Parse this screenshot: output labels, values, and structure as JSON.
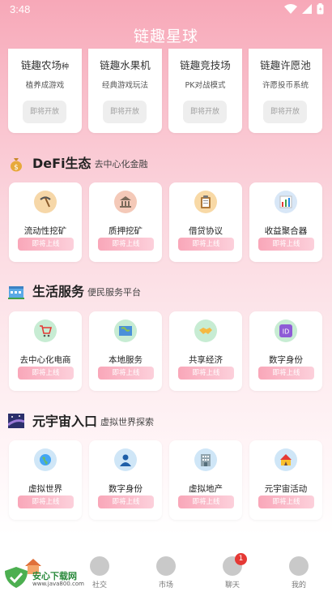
{
  "status_bar": {
    "time": "3:48"
  },
  "app": {
    "title": "链趣星球"
  },
  "games": [
    {
      "name": "链趣农场",
      "suffix": "种",
      "desc": "植养成游戏",
      "button": "即将开放"
    },
    {
      "name": "链趣水果机",
      "suffix": "",
      "desc": "经典游戏玩法",
      "button": "即将开放"
    },
    {
      "name": "链趣竞技场",
      "suffix": "",
      "desc": "PK对战模式",
      "button": "即将开放"
    },
    {
      "name": "链趣许愿池",
      "suffix": "",
      "desc": "许愿投币系统",
      "button": "即将开放"
    }
  ],
  "sections": {
    "defi": {
      "title": "DeFi生态",
      "subtitle": "去中心化金融",
      "icon": "money-bag-icon",
      "items": [
        {
          "label": "流动性挖矿",
          "button": "即将上线",
          "icon": "pickaxe-icon",
          "color": "#f6d7a8"
        },
        {
          "label": "质押挖矿",
          "button": "即将上线",
          "icon": "bank-icon",
          "color": "#f4c9b8"
        },
        {
          "label": "借贷协议",
          "button": "即将上线",
          "icon": "clipboard-icon",
          "color": "#f8d9a6"
        },
        {
          "label": "收益聚合器",
          "button": "即将上线",
          "icon": "bar-chart-icon",
          "color": "#d8e7f7"
        }
      ]
    },
    "life": {
      "title": "生活服务",
      "subtitle": "便民服务平台",
      "icon": "cityscape-icon",
      "items": [
        {
          "label": "去中心化电商",
          "button": "即将上线",
          "icon": "shopping-cart-icon",
          "color": "#c7ecd3"
        },
        {
          "label": "本地服务",
          "button": "即将上线",
          "icon": "map-icon",
          "color": "#c7ecd3"
        },
        {
          "label": "共享经济",
          "button": "即将上线",
          "icon": "handshake-icon",
          "color": "#c7ecd3"
        },
        {
          "label": "数字身份",
          "button": "即将上线",
          "icon": "id-badge-icon",
          "color": "#c7ecd3"
        }
      ]
    },
    "meta": {
      "title": "元宇宙入口",
      "subtitle": "虚拟世界探索",
      "icon": "night-sky-icon",
      "items": [
        {
          "label": "虚拟世界",
          "button": "即将上线",
          "icon": "globe-icon",
          "color": "#cfe6f7"
        },
        {
          "label": "数字身份",
          "button": "即将上线",
          "icon": "person-icon",
          "color": "#cfe6f7"
        },
        {
          "label": "虚拟地产",
          "button": "即将上线",
          "icon": "building-icon",
          "color": "#cfe6f7"
        },
        {
          "label": "元宇宙活动",
          "button": "即将上线",
          "icon": "circus-tent-icon",
          "color": "#cfe6f7"
        }
      ]
    }
  },
  "nav": {
    "items": [
      {
        "label": "",
        "icon": "home-icon"
      },
      {
        "label": "社交",
        "icon": "social-icon"
      },
      {
        "label": "市场",
        "icon": "market-icon"
      },
      {
        "label": "聊天",
        "icon": "chat-icon",
        "badge": "1"
      },
      {
        "label": "我的",
        "icon": "profile-icon"
      }
    ]
  },
  "watermark": {
    "text": "安心下载网",
    "url": "www.java800.com"
  }
}
